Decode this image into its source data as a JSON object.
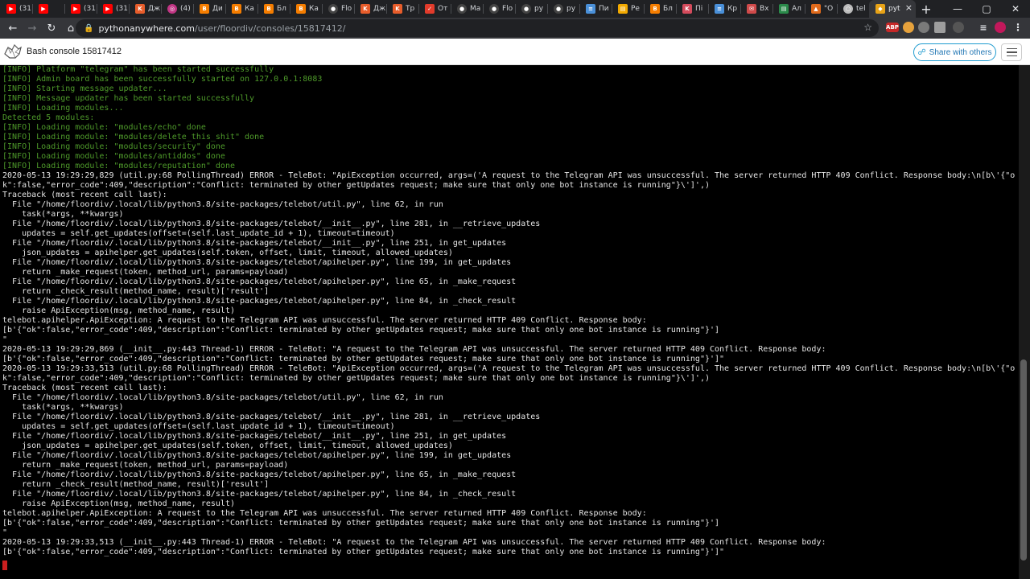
{
  "browser": {
    "tabs": [
      {
        "label": "(31",
        "icon": "youtube-icon",
        "color": "#ff0000"
      },
      {
        "label": "",
        "icon": "youtube-icon",
        "color": "#ff0000"
      },
      {
        "label": "(31",
        "icon": "youtube-icon",
        "color": "#ff0000"
      },
      {
        "label": "(31",
        "icon": "youtube-icon",
        "color": "#ff0000"
      },
      {
        "label": "Дж",
        "icon": "k-icon",
        "color": "#e85d2b"
      },
      {
        "label": "(4)",
        "icon": "instagram-icon",
        "color": "#c13584"
      },
      {
        "label": "Ди",
        "icon": "blogger-icon",
        "color": "#f57d00"
      },
      {
        "label": "Ка",
        "icon": "blogger-icon",
        "color": "#f57d00"
      },
      {
        "label": "Бл",
        "icon": "blogger-icon",
        "color": "#f57d00"
      },
      {
        "label": "Ка",
        "icon": "blogger-icon",
        "color": "#f57d00"
      },
      {
        "label": "Flo",
        "icon": "github-icon",
        "color": "#444444"
      },
      {
        "label": "Дж",
        "icon": "k-icon",
        "color": "#e85d2b"
      },
      {
        "label": "Тр",
        "icon": "k-icon",
        "color": "#e85d2b"
      },
      {
        "label": "От",
        "icon": "shield-icon",
        "color": "#e23b2b"
      },
      {
        "label": "Ма",
        "icon": "github-icon",
        "color": "#444444"
      },
      {
        "label": "Flo",
        "icon": "github-icon",
        "color": "#444444"
      },
      {
        "label": "py",
        "icon": "github-icon",
        "color": "#444444"
      },
      {
        "label": "py",
        "icon": "github-icon",
        "color": "#444444"
      },
      {
        "label": "Пи",
        "icon": "doc-icon",
        "color": "#4a90d9"
      },
      {
        "label": "Ре",
        "icon": "page-icon",
        "color": "#f2a900"
      },
      {
        "label": "Бл",
        "icon": "blogger-icon",
        "color": "#f57d00"
      },
      {
        "label": "Пі",
        "icon": "k-icon",
        "color": "#d44b5c"
      },
      {
        "label": "Кр",
        "icon": "doc-icon",
        "color": "#4a90d9"
      },
      {
        "label": "Вх",
        "icon": "mail-icon",
        "color": "#d04a4a"
      },
      {
        "label": "Ал",
        "icon": "page-icon",
        "color": "#2a8a4a"
      },
      {
        "label": "\"О",
        "icon": "flame-icon",
        "color": "#e06a1b"
      },
      {
        "label": "tel",
        "icon": "globe-icon",
        "color": "#bbbbbb"
      }
    ],
    "active_tab": {
      "label": "pyt",
      "icon": "python-icon",
      "color": "#e8a317"
    },
    "url_host": "pythonanywhere.com",
    "url_path": "/user/floordiv/consoles/15817412/"
  },
  "header": {
    "title": "Bash console 15817412",
    "share_label": "Share with others"
  },
  "terminal": {
    "lines": [
      {
        "text": "[INFO] Platform \"telegram\" has been started successfully",
        "kind": "info"
      },
      {
        "text": "[INFO] Admin board has been successfully started on 127.0.0.1:8083",
        "kind": "info"
      },
      {
        "text": "[INFO] Starting message updater...",
        "kind": "info"
      },
      {
        "text": "[INFO] Message updater has been started successfully",
        "kind": "info"
      },
      {
        "text": "[INFO] Loading modules...",
        "kind": "info"
      },
      {
        "text": "Detected 5 modules:",
        "kind": "info"
      },
      {
        "text": "[INFO] Loading module: \"modules/echo\" done",
        "kind": "info"
      },
      {
        "text": "[INFO] Loading module: \"modules/delete_this_shit\" done",
        "kind": "info"
      },
      {
        "text": "[INFO] Loading module: \"modules/security\" done",
        "kind": "info"
      },
      {
        "text": "[INFO] Loading module: \"modules/antiddos\" done",
        "kind": "info"
      },
      {
        "text": "[INFO] Loading module: \"modules/reputation\" done",
        "kind": "info"
      },
      {
        "text": "2020-05-13 19:29:29,829 (util.py:68 PollingThread) ERROR - TeleBot: \"ApiException occurred, args=('A request to the Telegram API was unsuccessful. The server returned HTTP 409 Conflict. Response body:\\n[b\\'{\"o",
        "kind": "plain"
      },
      {
        "text": "k\":false,\"error_code\":409,\"description\":\"Conflict: terminated by other getUpdates request; make sure that only one bot instance is running\"}\\']',)",
        "kind": "plain"
      },
      {
        "text": "Traceback (most recent call last):",
        "kind": "plain"
      },
      {
        "text": "  File \"/home/floordiv/.local/lib/python3.8/site-packages/telebot/util.py\", line 62, in run",
        "kind": "plain"
      },
      {
        "text": "    task(*args, **kwargs)",
        "kind": "plain"
      },
      {
        "text": "  File \"/home/floordiv/.local/lib/python3.8/site-packages/telebot/__init__.py\", line 281, in __retrieve_updates",
        "kind": "plain"
      },
      {
        "text": "    updates = self.get_updates(offset=(self.last_update_id + 1), timeout=timeout)",
        "kind": "plain"
      },
      {
        "text": "  File \"/home/floordiv/.local/lib/python3.8/site-packages/telebot/__init__.py\", line 251, in get_updates",
        "kind": "plain"
      },
      {
        "text": "    json_updates = apihelper.get_updates(self.token, offset, limit, timeout, allowed_updates)",
        "kind": "plain"
      },
      {
        "text": "  File \"/home/floordiv/.local/lib/python3.8/site-packages/telebot/apihelper.py\", line 199, in get_updates",
        "kind": "plain"
      },
      {
        "text": "    return _make_request(token, method_url, params=payload)",
        "kind": "plain"
      },
      {
        "text": "  File \"/home/floordiv/.local/lib/python3.8/site-packages/telebot/apihelper.py\", line 65, in _make_request",
        "kind": "plain"
      },
      {
        "text": "    return _check_result(method_name, result)['result']",
        "kind": "plain"
      },
      {
        "text": "  File \"/home/floordiv/.local/lib/python3.8/site-packages/telebot/apihelper.py\", line 84, in _check_result",
        "kind": "plain"
      },
      {
        "text": "    raise ApiException(msg, method_name, result)",
        "kind": "plain"
      },
      {
        "text": "telebot.apihelper.ApiException: A request to the Telegram API was unsuccessful. The server returned HTTP 409 Conflict. Response body:",
        "kind": "plain"
      },
      {
        "text": "[b'{\"ok\":false,\"error_code\":409,\"description\":\"Conflict: terminated by other getUpdates request; make sure that only one bot instance is running\"}']",
        "kind": "plain"
      },
      {
        "text": "\"",
        "kind": "plain"
      },
      {
        "text": "2020-05-13 19:29:29,869 (__init__.py:443 Thread-1) ERROR - TeleBot: \"A request to the Telegram API was unsuccessful. The server returned HTTP 409 Conflict. Response body:",
        "kind": "plain"
      },
      {
        "text": "[b'{\"ok\":false,\"error_code\":409,\"description\":\"Conflict: terminated by other getUpdates request; make sure that only one bot instance is running\"}']\"",
        "kind": "plain"
      },
      {
        "text": "2020-05-13 19:29:33,513 (util.py:68 PollingThread) ERROR - TeleBot: \"ApiException occurred, args=('A request to the Telegram API was unsuccessful. The server returned HTTP 409 Conflict. Response body:\\n[b\\'{\"o",
        "kind": "plain"
      },
      {
        "text": "k\":false,\"error_code\":409,\"description\":\"Conflict: terminated by other getUpdates request; make sure that only one bot instance is running\"}\\']',)",
        "kind": "plain"
      },
      {
        "text": "Traceback (most recent call last):",
        "kind": "plain"
      },
      {
        "text": "  File \"/home/floordiv/.local/lib/python3.8/site-packages/telebot/util.py\", line 62, in run",
        "kind": "plain"
      },
      {
        "text": "    task(*args, **kwargs)",
        "kind": "plain"
      },
      {
        "text": "  File \"/home/floordiv/.local/lib/python3.8/site-packages/telebot/__init__.py\", line 281, in __retrieve_updates",
        "kind": "plain"
      },
      {
        "text": "    updates = self.get_updates(offset=(self.last_update_id + 1), timeout=timeout)",
        "kind": "plain"
      },
      {
        "text": "  File \"/home/floordiv/.local/lib/python3.8/site-packages/telebot/__init__.py\", line 251, in get_updates",
        "kind": "plain"
      },
      {
        "text": "    json_updates = apihelper.get_updates(self.token, offset, limit, timeout, allowed_updates)",
        "kind": "plain"
      },
      {
        "text": "  File \"/home/floordiv/.local/lib/python3.8/site-packages/telebot/apihelper.py\", line 199, in get_updates",
        "kind": "plain"
      },
      {
        "text": "    return _make_request(token, method_url, params=payload)",
        "kind": "plain"
      },
      {
        "text": "  File \"/home/floordiv/.local/lib/python3.8/site-packages/telebot/apihelper.py\", line 65, in _make_request",
        "kind": "plain"
      },
      {
        "text": "    return _check_result(method_name, result)['result']",
        "kind": "plain"
      },
      {
        "text": "  File \"/home/floordiv/.local/lib/python3.8/site-packages/telebot/apihelper.py\", line 84, in _check_result",
        "kind": "plain"
      },
      {
        "text": "    raise ApiException(msg, method_name, result)",
        "kind": "plain"
      },
      {
        "text": "telebot.apihelper.ApiException: A request to the Telegram API was unsuccessful. The server returned HTTP 409 Conflict. Response body:",
        "kind": "plain"
      },
      {
        "text": "[b'{\"ok\":false,\"error_code\":409,\"description\":\"Conflict: terminated by other getUpdates request; make sure that only one bot instance is running\"}']",
        "kind": "plain"
      },
      {
        "text": "\"",
        "kind": "plain"
      },
      {
        "text": "2020-05-13 19:29:33,513 (__init__.py:443 Thread-1) ERROR - TeleBot: \"A request to the Telegram API was unsuccessful. The server returned HTTP 409 Conflict. Response body:",
        "kind": "plain"
      },
      {
        "text": "[b'{\"ok\":false,\"error_code\":409,\"description\":\"Conflict: terminated by other getUpdates request; make sure that only one bot instance is running\"}']\"",
        "kind": "plain"
      }
    ]
  },
  "colors": {
    "info_text": "#4e9a2a",
    "cursor": "#cc1f1f",
    "share_border": "#1f9bcf"
  }
}
